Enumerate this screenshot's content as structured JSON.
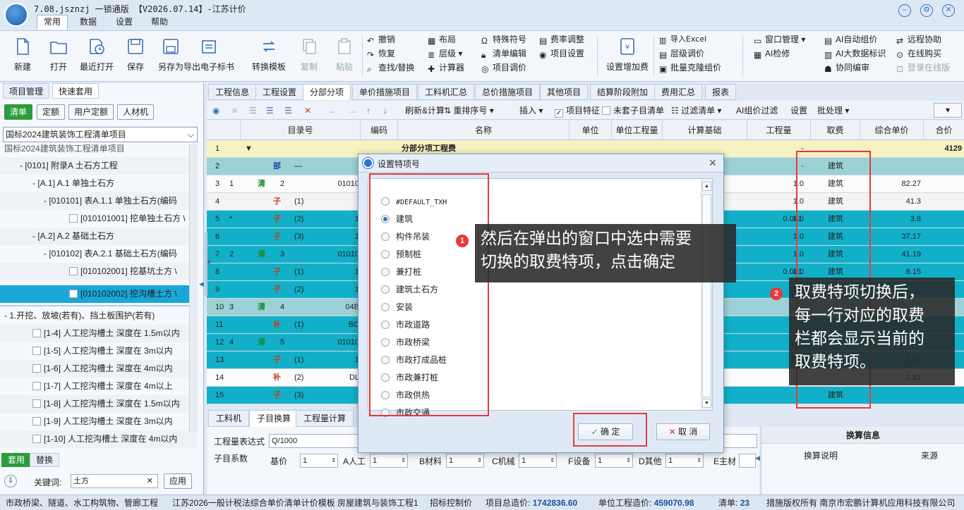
{
  "app": {
    "title": "7.08.jsznzj 一锁通版 【V2026.07.14】-江苏计价",
    "menu_tabs": [
      "常用",
      "数据",
      "设置",
      "帮助"
    ]
  },
  "ribbon": {
    "big": [
      {
        "id": "new",
        "label": "新建"
      },
      {
        "id": "open",
        "label": "打开"
      },
      {
        "id": "recent",
        "label": "最近打开"
      },
      {
        "id": "save",
        "label": "保存"
      },
      {
        "id": "saveas",
        "label": "另存为"
      },
      {
        "id": "export",
        "label": "导出电子标书"
      },
      {
        "id": "convert",
        "label": "转换模板"
      },
      {
        "id": "copy",
        "label": "复制"
      },
      {
        "id": "paste",
        "label": "粘贴"
      }
    ],
    "small_col1": [
      "撤销",
      "恢复",
      "查找/替换"
    ],
    "small_col2": [
      "布局",
      "层级",
      "计算器"
    ],
    "small_col3": [
      "特殊符号",
      "清单编辑",
      "项目调价"
    ],
    "small_col4": [
      "费率调整",
      "项目设置"
    ],
    "big2": {
      "label": "设置增加费"
    },
    "small_col5": [
      "导入Excel",
      "层级调价",
      "批量克隆组价"
    ],
    "small_col6": [
      "窗口管理",
      "AI检修"
    ],
    "small_col7": [
      "AI自动组价",
      "AI大数据标识",
      "协同编审"
    ],
    "small_col8": [
      "远程协助",
      "在线购买",
      "登录在线版"
    ]
  },
  "left": {
    "tabs": [
      "项目管理",
      "快速套用"
    ],
    "buttons": [
      "清单",
      "定额",
      "用户定额",
      "人材机"
    ],
    "library": "国标2024建筑装饰工程清单项目",
    "tree": [
      "国标2024建筑装饰工程清单项目",
      "[0101] 附录A 土石方工程",
      "[A.1] A.1 单独土石方",
      "[010101] 表A.1.1 单独土石方(编码",
      "[010101001] 挖单独土石方 \\",
      "[A.2] A.2 基础土石方",
      "[010102] 表A.2.1 基础土石方(编码",
      "[010102001] 挖基坑土方 \\",
      "[010102002] 挖沟槽土方 \\"
    ],
    "subtree_title": "1.开挖、放坡(若有)、挡土板围护(若有)",
    "subtree": [
      "[1-4] 人工挖沟槽土 深度在 1.5m以内",
      "[1-5] 人工挖沟槽土 深度在 3m以内",
      "[1-6] 人工挖沟槽土 深度在 4m以内",
      "[1-7] 人工挖沟槽土 深度在 4m以上",
      "[1-8] 人工挖沟槽土 深度在 1.5m以内",
      "[1-9] 人工挖沟槽土 深度在 3m以内",
      "[1-10] 人工挖沟槽土 深度在 4m以内"
    ],
    "bottom_tabs": [
      "套用",
      "替换"
    ],
    "keyword_label": "关键词:",
    "keyword_value": "土方",
    "apply_label": "应用"
  },
  "main": {
    "tabs": [
      "工程信息",
      "工程设置",
      "分部分项",
      "单价措施项目",
      "工料机汇总",
      "总价措施项目",
      "其他项目",
      "结算阶段附加",
      "费用汇总",
      "报表"
    ],
    "toolbar": [
      "刷新&计算",
      "重排序号",
      "插入",
      "项目特征",
      "未套子目清单",
      "过滤清单",
      "AI组价过滤",
      "设置",
      "批处理"
    ],
    "headers": [
      "目录号",
      "编码",
      "名称",
      "单位",
      "单位工程量",
      "计算基础",
      "工程量",
      "取费",
      "综合单价",
      "合价"
    ],
    "rows": [
      {
        "no": "1",
        "sub": "",
        "code": "",
        "name": "分部分项工程费",
        "qty": "-",
        "fee": "",
        "price": "",
        "total": "4129",
        "style": "yellow",
        "type": "",
        "seq": ""
      },
      {
        "no": "2",
        "sub": "",
        "code": "",
        "name": "",
        "qty": "-",
        "fee": "建筑",
        "price": "",
        "total": "",
        "style": "teal",
        "type": "部",
        "seq": "—"
      },
      {
        "no": "3",
        "sub": "1",
        "code": "01010",
        "name": "",
        "qty": "1.0",
        "fee": "建筑",
        "price": "82.27",
        "total": "",
        "style": "white",
        "type": "清",
        "seq": "2"
      },
      {
        "no": "4",
        "sub": "",
        "code": "",
        "name": "",
        "qty": "1.0",
        "fee": "建筑",
        "price": "41.3",
        "total": "",
        "style": "light",
        "type": "子",
        "seq": "(1)"
      },
      {
        "no": "5",
        "sub": "*",
        "code": "1",
        "name": "",
        "qty": "1.0",
        "fee": "建筑",
        "price": "3.8",
        "total": "",
        "style": "cyan",
        "type": "子",
        "seq": "(2)",
        "unitqty": "0.001"
      },
      {
        "no": "6",
        "sub": "",
        "code": "1",
        "name": "",
        "qty": "1.0",
        "fee": "建筑",
        "price": "37.17",
        "total": "",
        "style": "cyan",
        "type": "子",
        "seq": "(3)"
      },
      {
        "no": "7",
        "sub": "2",
        "code": "01010",
        "name": "",
        "qty": "1.0",
        "fee": "建筑",
        "price": "41.19",
        "total": "",
        "style": "cyan",
        "type": "清",
        "seq": "3"
      },
      {
        "no": "8",
        "sub": "",
        "code": "1",
        "name": "",
        "qty": "1.0",
        "fee": "建筑",
        "price": "8.15",
        "total": "",
        "style": "cyan",
        "type": "子",
        "seq": "(1)",
        "unitqty": "0.001"
      },
      {
        "no": "9",
        "sub": "",
        "code": "1",
        "name": "",
        "qty": "1.0",
        "fee": "建筑",
        "price": "",
        "total": "",
        "style": "cyan",
        "type": "子",
        "seq": "(2)"
      },
      {
        "no": "10",
        "sub": "3",
        "code": "04B",
        "name": "",
        "qty": "",
        "fee": "",
        "price": "",
        "total": "",
        "style": "teal",
        "type": "清",
        "seq": "4"
      },
      {
        "no": "11",
        "sub": "",
        "code": "BC",
        "name": "",
        "qty": "",
        "fee": "",
        "price": "",
        "total": "",
        "style": "cyan",
        "type": "补",
        "seq": "(1)"
      },
      {
        "no": "12",
        "sub": "4",
        "code": "01010",
        "name": "",
        "qty": "",
        "fee": "",
        "price": "",
        "total": "",
        "style": "cyan",
        "type": "清",
        "seq": "5"
      },
      {
        "no": "13",
        "sub": "",
        "code": "1",
        "name": "",
        "qty": "",
        "fee": "",
        "price": "1.05",
        "total": "",
        "style": "cyan",
        "type": "子",
        "seq": "(1)",
        "unitqty": "0.0"
      },
      {
        "no": "14",
        "sub": "",
        "code": "DL",
        "name": "",
        "qty": "",
        "fee": "",
        "price": "1.12",
        "total": "",
        "style": "white",
        "type": "补",
        "seq": "(2)"
      },
      {
        "no": "15",
        "sub": "",
        "code": "",
        "name": "",
        "qty": "",
        "fee": "建筑",
        "price": "",
        "total": "",
        "style": "cyan",
        "type": "子",
        "seq": "(3)"
      }
    ]
  },
  "bottom": {
    "tabs": [
      "工料机",
      "子目换算",
      "工程量计算"
    ],
    "expr_label": "工程量表达式",
    "expr_value": "Q/1000",
    "coef_label": "子目系数",
    "coef_fields": [
      {
        "label": "基价",
        "value": "1"
      },
      {
        "label": "A人工",
        "value": "1"
      },
      {
        "label": "B材料",
        "value": "1"
      },
      {
        "label": "C机械",
        "value": "1"
      },
      {
        "label": "F设备",
        "value": "1"
      },
      {
        "label": "D其他",
        "value": "1"
      },
      {
        "label": "E主材",
        "value": ""
      }
    ],
    "info_title": "换算信息",
    "info_cols": [
      "换算说明",
      "来源"
    ]
  },
  "dialog": {
    "title": "设置特项号",
    "options": [
      "#DEFAULT_TXH",
      "建筑",
      "构件吊装",
      "预制桩",
      "兼打桩",
      "建筑土石方",
      "安装",
      "市政道路",
      "市政桥梁",
      "市政打成品桩",
      "市政兼打桩",
      "市政供热",
      "市政交通"
    ],
    "selected_index": 1,
    "ok_label": "确 定",
    "cancel_label": "取 消"
  },
  "annotations": {
    "note1": "然后在弹出的窗口中选中需要切换的取费特项，点击确定",
    "note1_lines": [
      "然后在弹出的窗口中选中需要",
      "切换的取费特项，点击确定"
    ],
    "note2_lines": [
      "取费特项切换后，",
      "每一行对应的取费",
      "栏都会显示当前的",
      "取费特项。"
    ],
    "badge1": "1",
    "badge2": "2"
  },
  "status": {
    "s1": "市政桥梁、隧道、水工构筑物、管廊工程",
    "s2": "江苏2026一般计税法综合单价清单计价模板 房屋建筑与装饰工程1",
    "s3": "招标控制价",
    "total_label": "项目总造价:",
    "total_value": "1742836.60",
    "unit_label": "单位工程造价:",
    "unit_value": "459070.98",
    "list_label": "清单:",
    "list_value": "23",
    "copyright": "措施版权所有 南京市宏鹏计算机应用科技有限公司"
  },
  "colors": {
    "accent": "#2a74c9",
    "annotation_red": "#e8393a",
    "row_cyan": "#12b0c8",
    "row_yellow": "#f6f2c2"
  }
}
